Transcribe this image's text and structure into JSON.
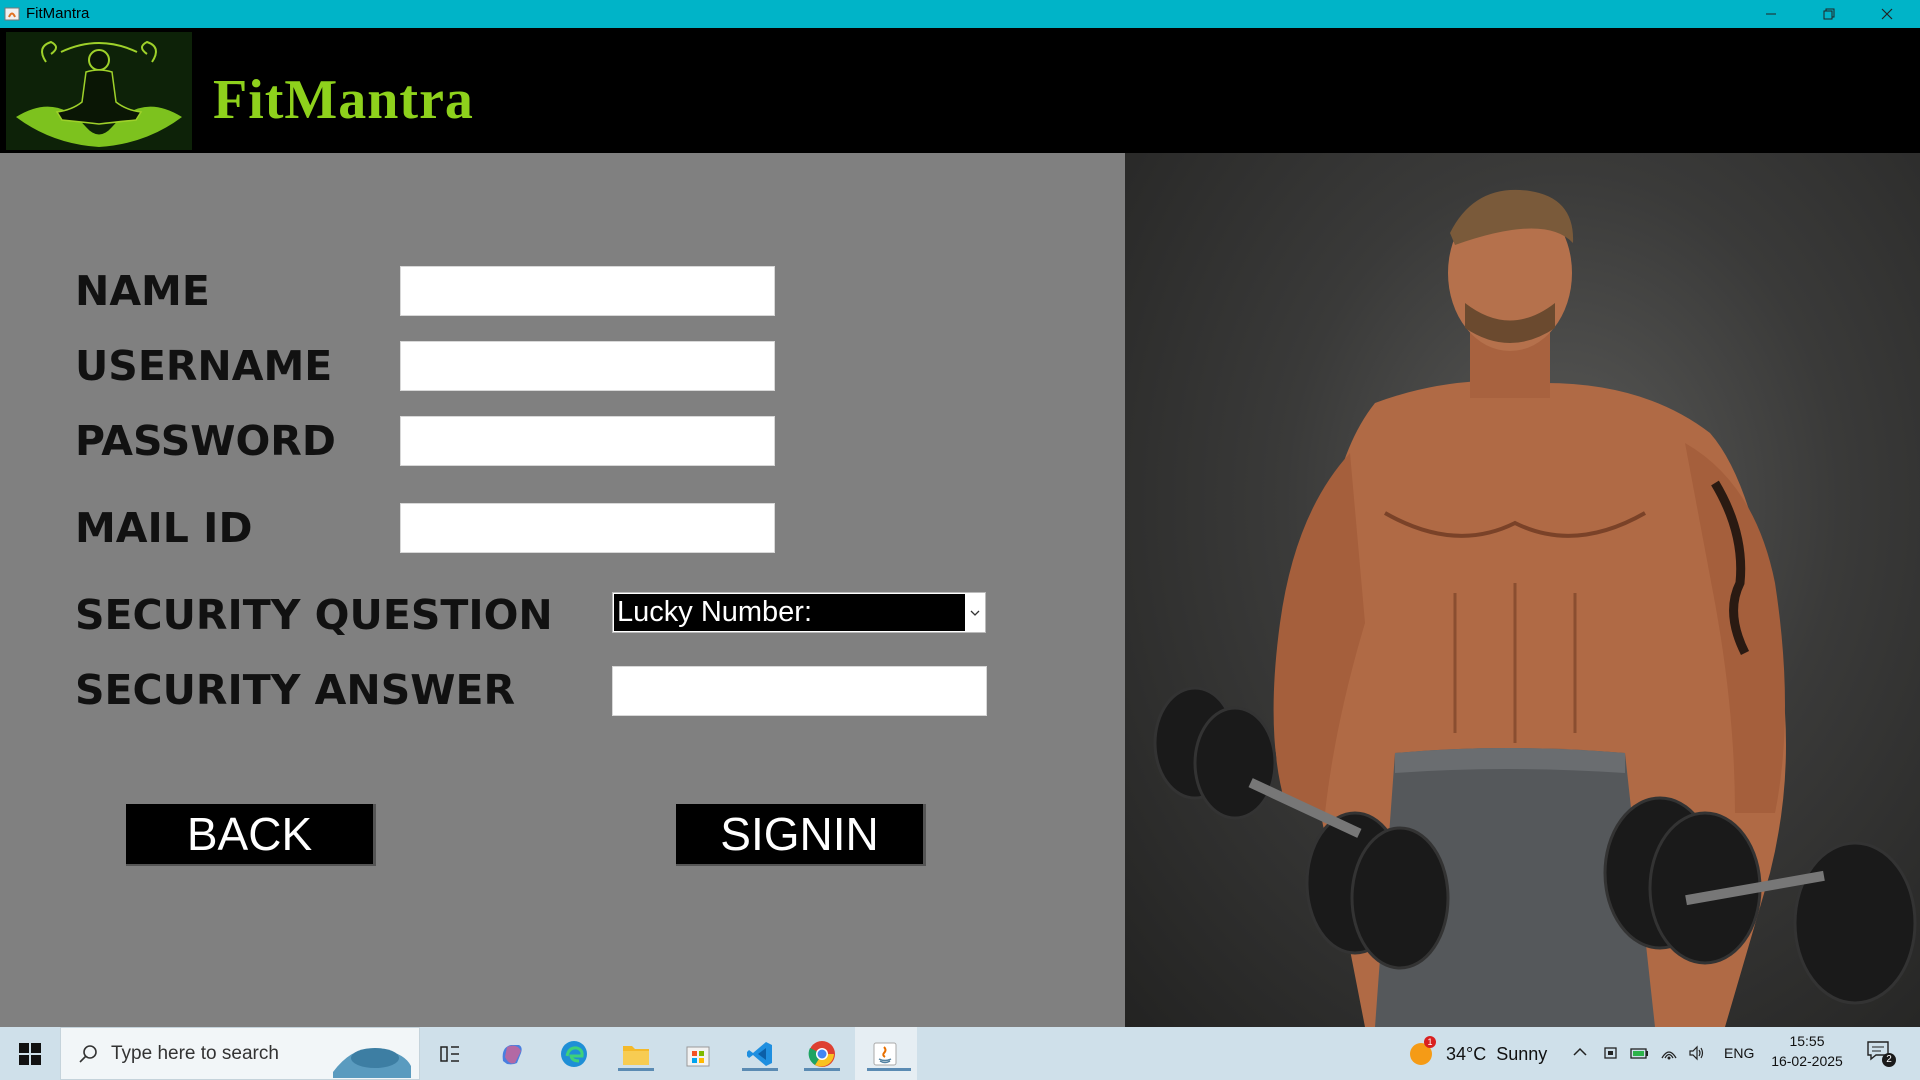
{
  "window": {
    "title": "FitMantra"
  },
  "header": {
    "brand": "FitMantra"
  },
  "form": {
    "name_label": "NAME",
    "username_label": "USERNAME",
    "password_label": "PASSWORD",
    "mail_label": "MAIL ID",
    "security_question_label": "SECURITY QUESTION",
    "security_answer_label": "SECURITY ANSWER",
    "name_value": "",
    "username_value": "",
    "password_value": "",
    "mail_value": "",
    "security_answer_value": "",
    "security_question_selected": "Lucky Number:",
    "back_label": "BACK",
    "signin_label": "SIGNIN"
  },
  "taskbar": {
    "search_placeholder": "Type here to search",
    "weather": "34°C  Sunny",
    "language": "ENG",
    "time": "15:55",
    "date": "16-02-2025",
    "notification_count": "2",
    "weather_badge": "1"
  },
  "colors": {
    "titlebar": "#00b4c8",
    "brand": "#8ed11c",
    "form_bg": "#808080",
    "header_bg": "#000000"
  },
  "icons": [
    "app-icon",
    "minimize-icon",
    "restore-icon",
    "close-icon",
    "chevron-down-icon",
    "windows-start-icon",
    "search-icon",
    "task-view-icon",
    "copilot-icon",
    "edge-icon",
    "file-explorer-icon",
    "store-icon",
    "vscode-icon",
    "chrome-icon",
    "java-icon",
    "weather-icon",
    "chevron-up-icon",
    "meet-icon",
    "battery-icon",
    "network-icon",
    "volume-icon",
    "notification-icon"
  ]
}
